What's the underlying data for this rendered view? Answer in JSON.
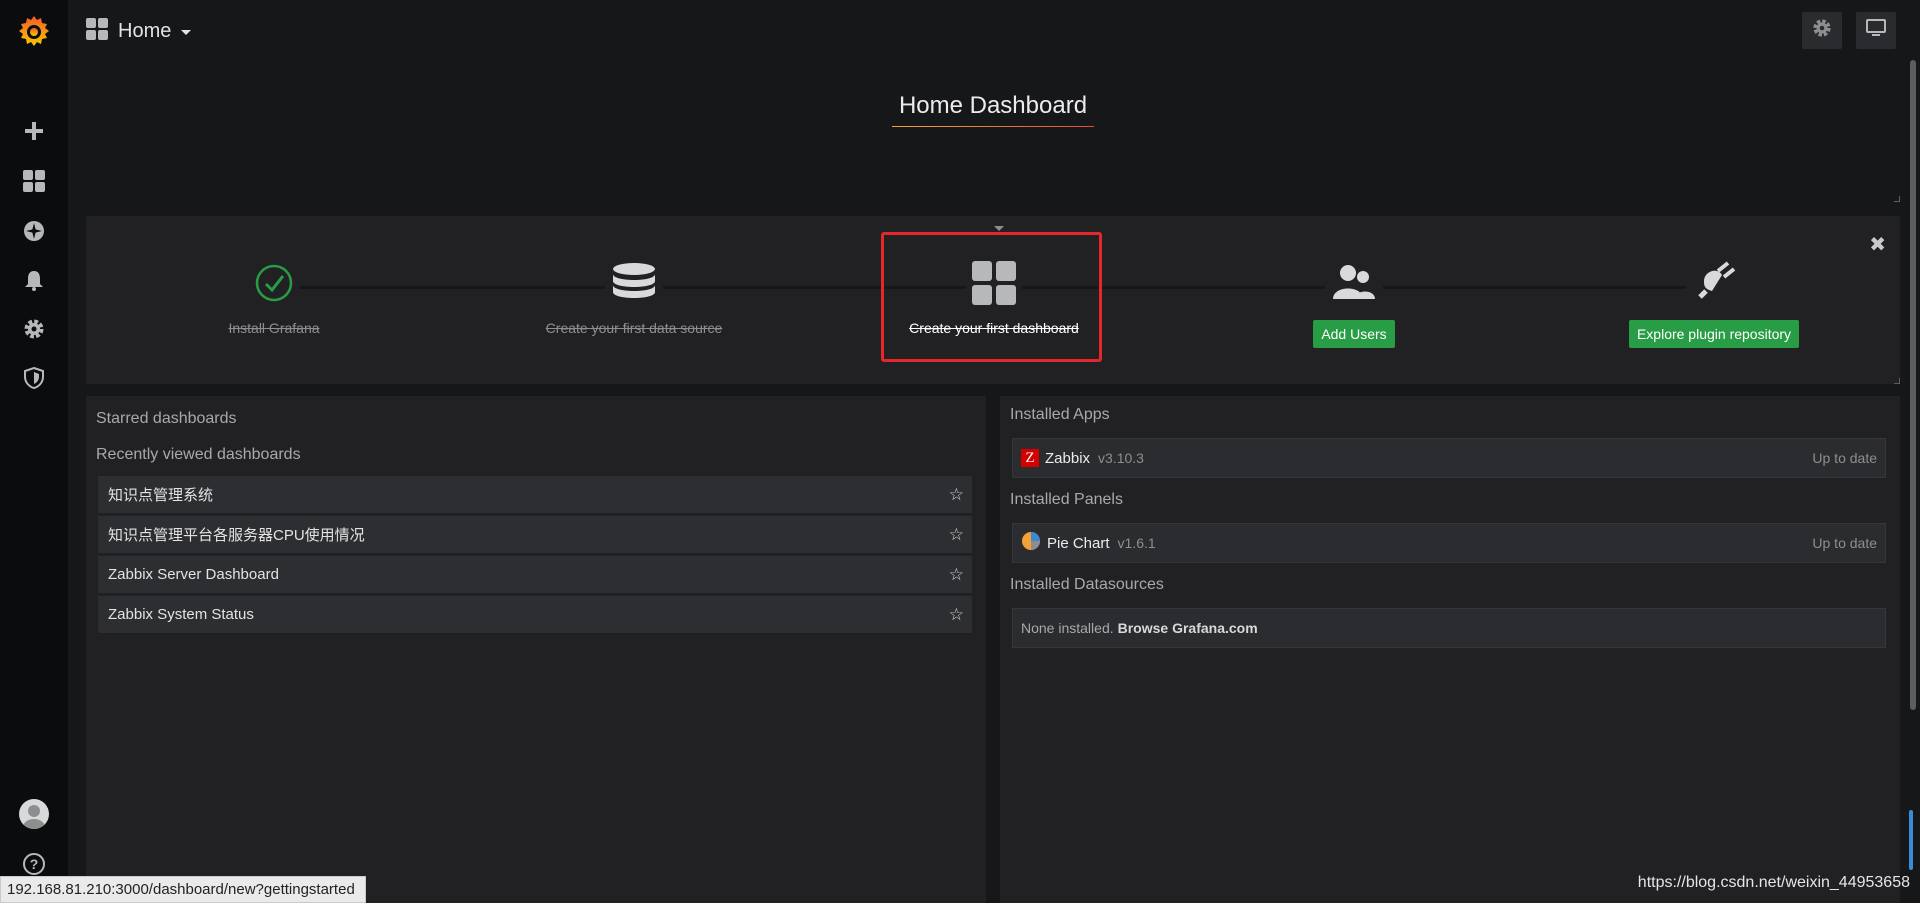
{
  "topnav": {
    "home_label": "Home"
  },
  "title_panel": {
    "title": "Home Dashboard"
  },
  "getting_started": {
    "steps": [
      {
        "label": "Install Grafana",
        "icon": "check-circle-icon"
      },
      {
        "label": "Create your first data source",
        "icon": "database-icon"
      },
      {
        "label": "Create your first dashboard",
        "icon": "grid-icon"
      },
      {
        "label": "Add Users",
        "icon": "users-icon"
      },
      {
        "label": "Explore plugin repository",
        "icon": "plug-icon"
      }
    ]
  },
  "dashboards": {
    "starred_title": "Starred dashboards",
    "recent_title": "Recently viewed dashboards",
    "items": [
      {
        "name": "知识点管理系统"
      },
      {
        "name": "知识点管理平台各服务器CPU使用情况"
      },
      {
        "name": "Zabbix Server Dashboard"
      },
      {
        "name": "Zabbix System Status"
      }
    ]
  },
  "plugins": {
    "apps_title": "Installed Apps",
    "panels_title": "Installed Panels",
    "datasources_title": "Installed Datasources",
    "apps": [
      {
        "name": "Zabbix",
        "version": "v3.10.3",
        "status": "Up to date"
      }
    ],
    "panels": [
      {
        "name": "Pie Chart",
        "version": "v1.6.1",
        "status": "Up to date"
      }
    ],
    "datasources_empty": "None installed.",
    "datasources_link": "Browse Grafana.com"
  },
  "statusbar": {
    "url": "192.168.81.210:3000/dashboard/new?gettingstarted"
  },
  "watermark": "https://blog.csdn.net/weixin_44953658",
  "colors": {
    "accent_green": "#299c46",
    "highlight_red": "#e5262a",
    "brand_orange": "#f3a237"
  }
}
